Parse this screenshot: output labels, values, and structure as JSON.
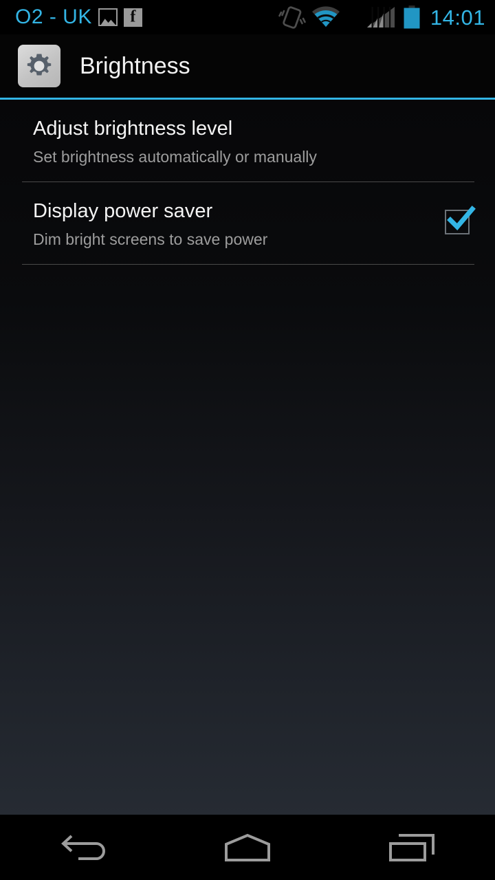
{
  "status_bar": {
    "carrier": "O2 - UK",
    "clock": "14:01",
    "accent_color": "#33b5e5",
    "icons": {
      "photo": "photo-icon",
      "facebook": "facebook-icon",
      "vibrate": "vibrate-icon",
      "wifi": "wifi-icon",
      "signal": "signal-bars-icon",
      "battery": "battery-icon"
    }
  },
  "action_bar": {
    "title": "Brightness",
    "icon": "settings-gear-icon",
    "underline_color": "#33b5e5"
  },
  "preferences": [
    {
      "title": "Adjust brightness level",
      "summary": "Set brightness automatically or manually",
      "widget": "none"
    },
    {
      "title": "Display power saver",
      "summary": "Dim bright screens to save power",
      "widget": "checkbox",
      "checked": true
    }
  ],
  "nav_bar": {
    "buttons": [
      {
        "name": "back",
        "label": "Back"
      },
      {
        "name": "home",
        "label": "Home"
      },
      {
        "name": "recents",
        "label": "Recent apps"
      }
    ]
  }
}
